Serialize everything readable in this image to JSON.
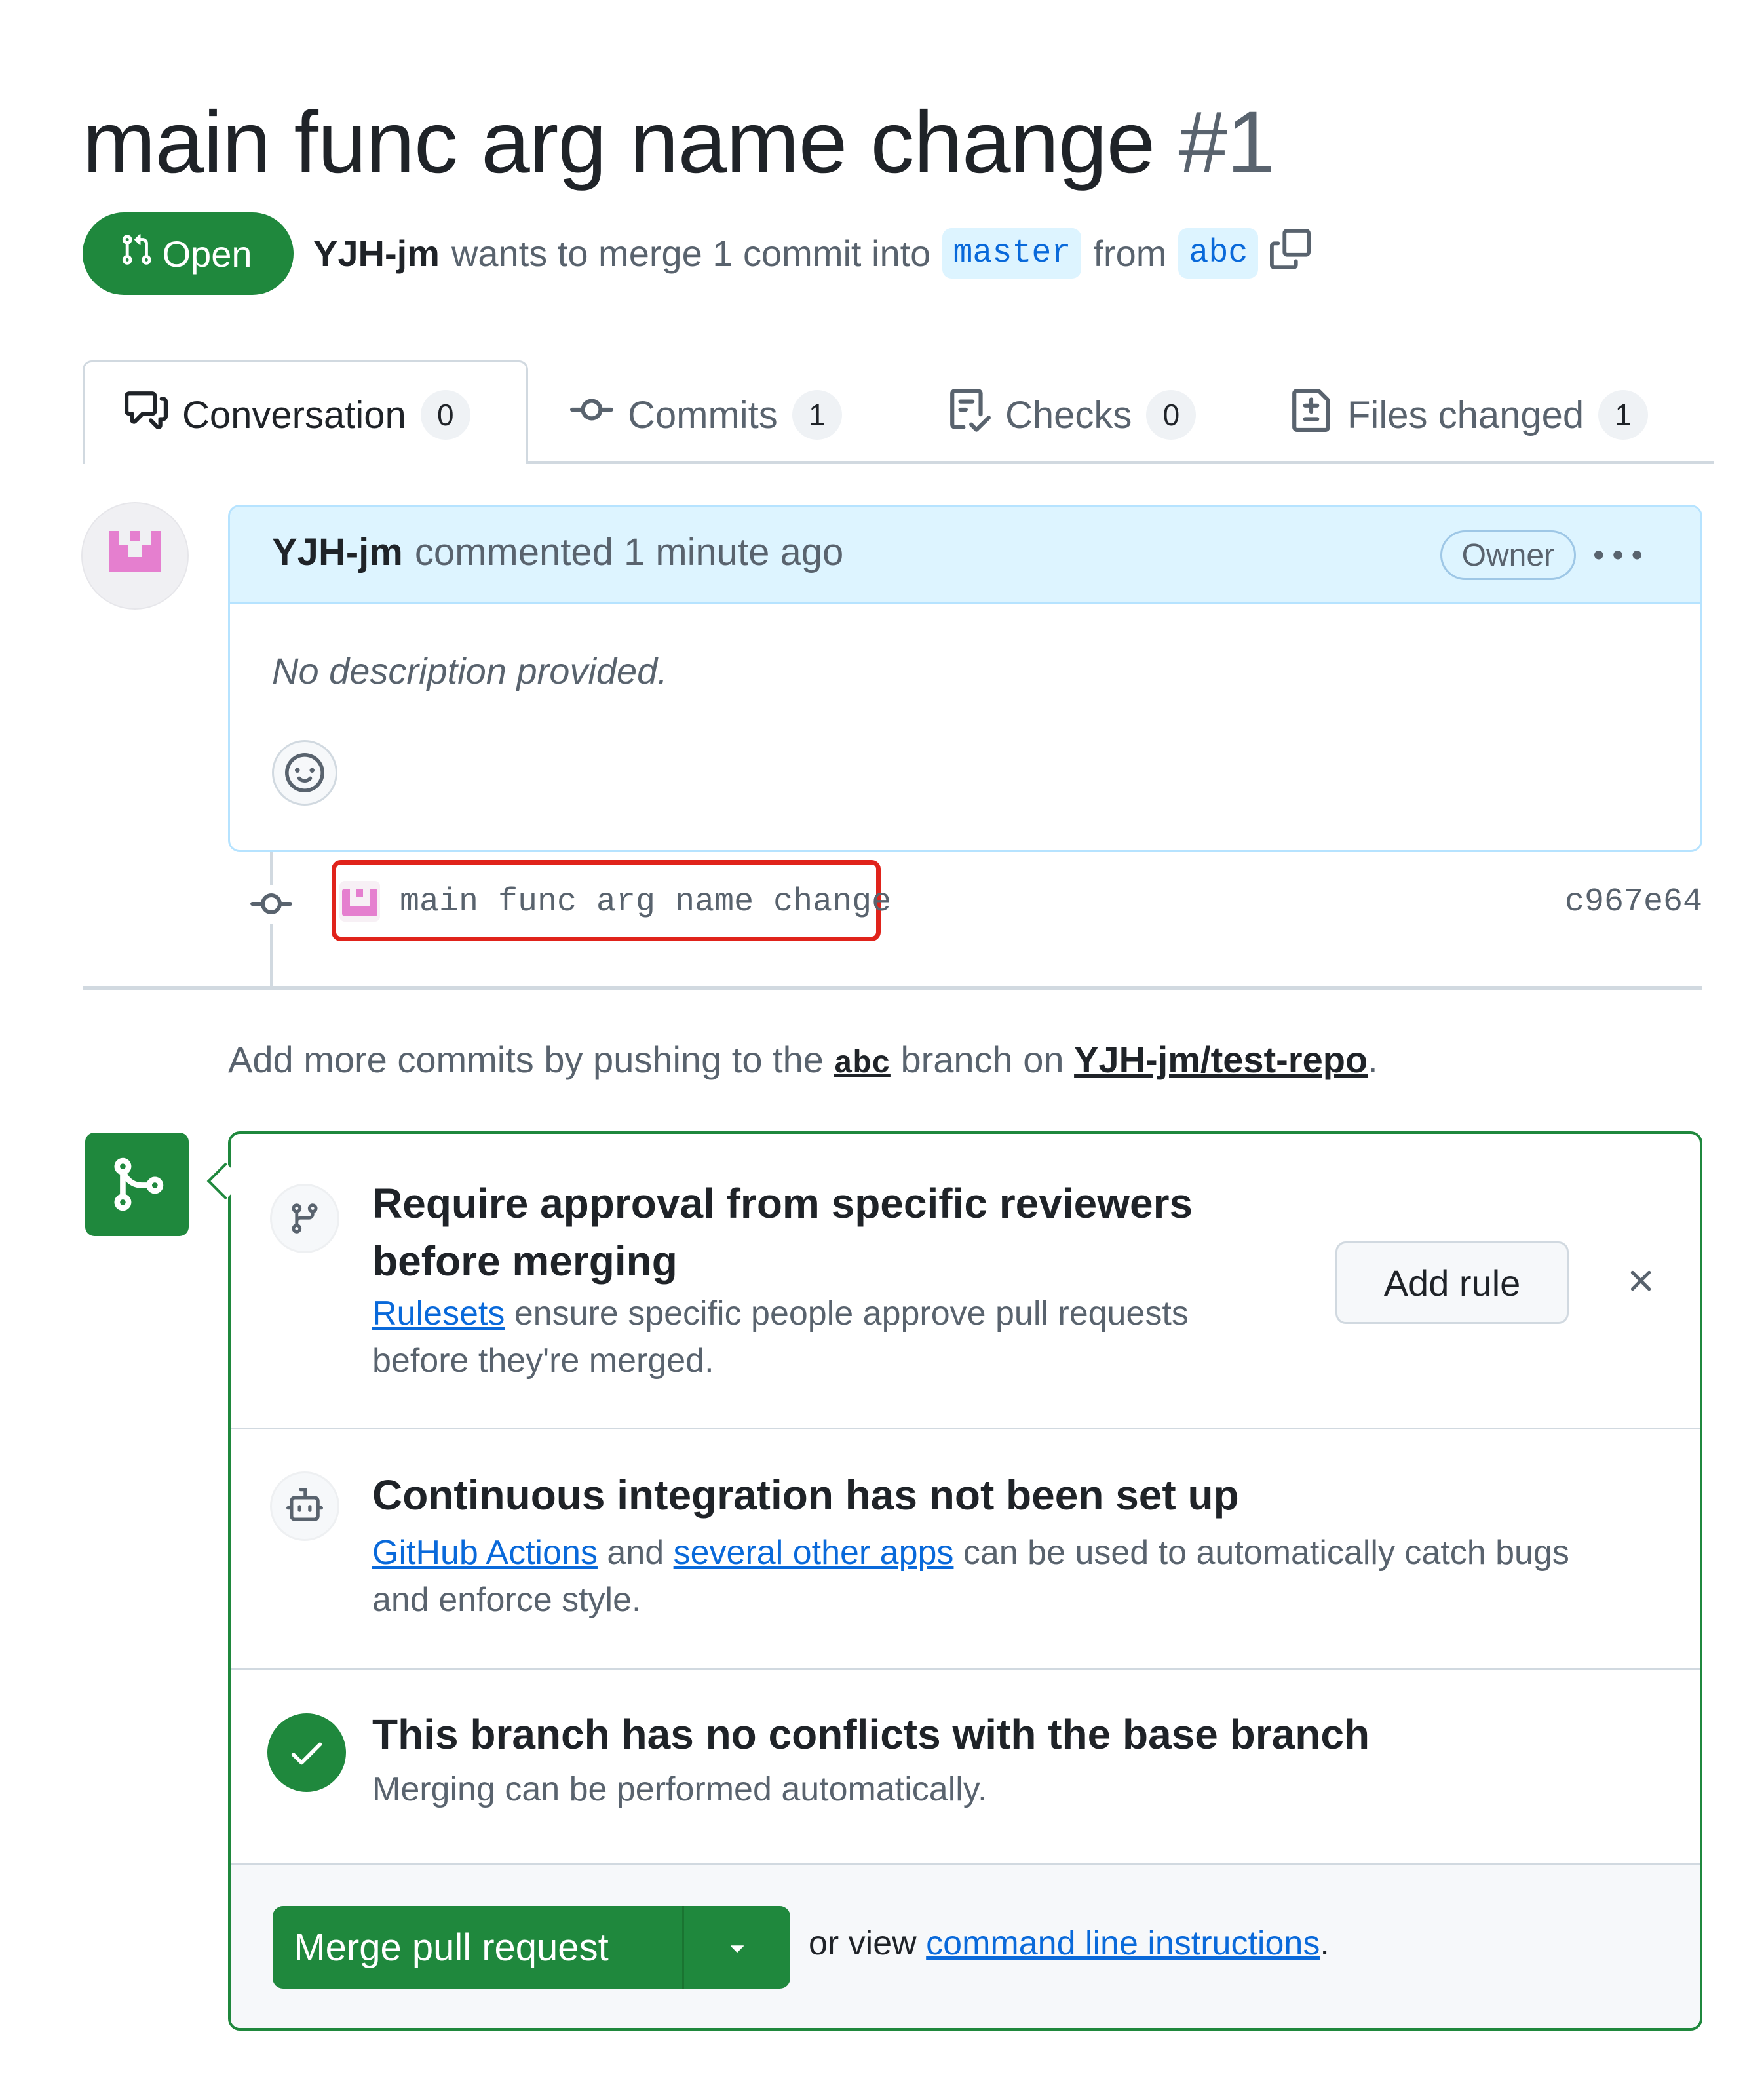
{
  "pr": {
    "title": "main func arg name change",
    "number": "#1",
    "state_label": "Open",
    "author": "YJH-jm",
    "merge_text": "wants to merge 1 commit into",
    "base_branch": "master",
    "from_text": "from",
    "head_branch": "abc"
  },
  "tabs": [
    {
      "label": "Conversation",
      "count": "0"
    },
    {
      "label": "Commits",
      "count": "1"
    },
    {
      "label": "Checks",
      "count": "0"
    },
    {
      "label": "Files changed",
      "count": "1"
    }
  ],
  "comment": {
    "author": "YJH-jm",
    "action": "commented 1 minute ago",
    "role_badge": "Owner",
    "body": "No description provided."
  },
  "commit": {
    "message": "main func arg name change",
    "sha": "c967e64"
  },
  "push_hint": {
    "prefix": "Add more commits by pushing to the",
    "branch": "abc",
    "middle": "branch on",
    "repo": "YJH-jm/test-repo",
    "suffix": "."
  },
  "merge_box": {
    "rules": {
      "title_line1": "Require approval from specific reviewers",
      "title_line2": "before merging",
      "link": "Rulesets",
      "text_line1": "ensure specific people approve pull requests",
      "text_line2": "before they're merged.",
      "button": "Add rule"
    },
    "ci": {
      "title": "Continuous integration has not been set up",
      "link1": "GitHub Actions",
      "and": "and",
      "link2": "several other apps",
      "text_line1": "can be used to automatically catch bugs",
      "text_line2": "and enforce style."
    },
    "conflicts": {
      "title": "This branch has no conflicts with the base branch",
      "text": "Merging can be performed automatically."
    },
    "footer": {
      "merge_button": "Merge pull request",
      "or_view": "or view",
      "cli_link": "command line instructions",
      "period": "."
    }
  },
  "colors": {
    "success_green": "#1f883d",
    "accent_blue": "#0969da",
    "highlight_red": "#e0231b",
    "comment_header_bg": "#ddf4ff"
  }
}
